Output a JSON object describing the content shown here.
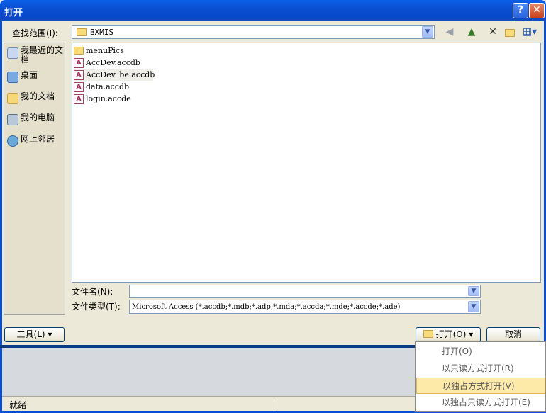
{
  "window": {
    "title": "打开",
    "help_label": "?",
    "close_label": "✕"
  },
  "lookin": {
    "label": "查找范围(I):",
    "value": "BXMIS"
  },
  "places": [
    {
      "label": "我最近的文档",
      "icon": "recent-documents-icon"
    },
    {
      "label": "桌面",
      "icon": "desktop-icon"
    },
    {
      "label": "我的文档",
      "icon": "my-documents-icon"
    },
    {
      "label": "我的电脑",
      "icon": "my-computer-icon"
    },
    {
      "label": "网上邻居",
      "icon": "network-places-icon"
    }
  ],
  "files": [
    {
      "name": "menuPics",
      "icon": "folder-icon"
    },
    {
      "name": "AccDev.accdb",
      "icon": "access-file-icon"
    },
    {
      "name": "AccDev_be.accdb",
      "icon": "access-file-icon"
    },
    {
      "name": "data.accdb",
      "icon": "access-file-icon"
    },
    {
      "name": "login.accde",
      "icon": "access-file-icon"
    }
  ],
  "filename": {
    "label": "文件名(N):",
    "value": ""
  },
  "filetype": {
    "label": "文件类型(T):",
    "value": "Microsoft Access (*.accdb;*.mdb;*.adp;*.mda;*.accda;*.mde;*.accde;*.ade)"
  },
  "buttons": {
    "tools": "工具(L)",
    "open": "打开(O)",
    "cancel": "取消"
  },
  "open_menu": [
    "打开(O)",
    "以只读方式打开(R)",
    "以独占方式打开(V)",
    "以独占只读方式打开(E)"
  ],
  "status": {
    "text": "就绪"
  },
  "colors": {
    "titlebar": "#0a4fd2",
    "menu_highlight": "#fde9a8"
  }
}
